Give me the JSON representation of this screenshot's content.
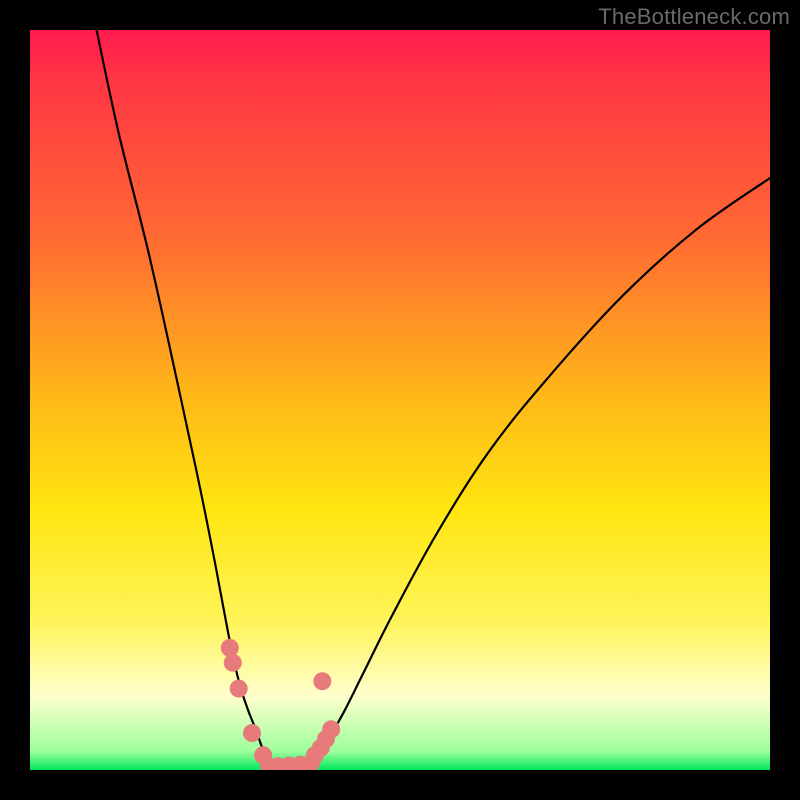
{
  "watermark": "TheBottleneck.com",
  "chart_data": {
    "type": "line",
    "title": "",
    "xlabel": "",
    "ylabel": "",
    "xlim": [
      0,
      100
    ],
    "ylim": [
      0,
      100
    ],
    "series": [
      {
        "name": "curve-left",
        "x": [
          9,
          12,
          16,
          20,
          23,
          25,
          26.5,
          27.5,
          28.5,
          29.5,
          30.5,
          31.2,
          31.8,
          32.3
        ],
        "y": [
          100,
          86,
          70,
          52,
          38,
          28,
          20,
          15,
          11,
          8,
          5.5,
          3.5,
          2,
          0.5
        ]
      },
      {
        "name": "curve-right",
        "x": [
          38,
          39,
          40.5,
          42.5,
          45,
          49,
          55,
          62,
          70,
          80,
          90,
          100
        ],
        "y": [
          0.5,
          2,
          4.5,
          8,
          13,
          21,
          32,
          43,
          53,
          64,
          73,
          80
        ]
      },
      {
        "name": "marker-cluster-left",
        "type": "scatter",
        "x": [
          27.0,
          27.4,
          28.2,
          30.0,
          31.5,
          32.3
        ],
        "y": [
          16.5,
          14.5,
          11.0,
          5.0,
          2.0,
          0.5
        ]
      },
      {
        "name": "marker-cluster-right",
        "type": "scatter",
        "x": [
          33.5,
          35.0,
          36.5,
          37.8,
          38.0,
          38.5,
          39.3,
          40.0,
          40.7
        ],
        "y": [
          0.5,
          0.6,
          0.7,
          0.8,
          1.0,
          2.0,
          3.0,
          4.2,
          5.5
        ]
      },
      {
        "name": "marker-right-upper",
        "type": "scatter",
        "x": [
          39.5
        ],
        "y": [
          12.0
        ]
      }
    ],
    "background_gradient": {
      "type": "vertical",
      "stops": [
        {
          "pos": 0.0,
          "color": "#ff1a4d"
        },
        {
          "pos": 0.28,
          "color": "#ff6a33"
        },
        {
          "pos": 0.5,
          "color": "#ffb918"
        },
        {
          "pos": 0.8,
          "color": "#fff45a"
        },
        {
          "pos": 0.9,
          "color": "#ffffcc"
        },
        {
          "pos": 1.0,
          "color": "#00e65c"
        }
      ]
    },
    "curve_color": "#000000",
    "marker_color": "#e77b7b",
    "marker_radius_px": 9
  }
}
